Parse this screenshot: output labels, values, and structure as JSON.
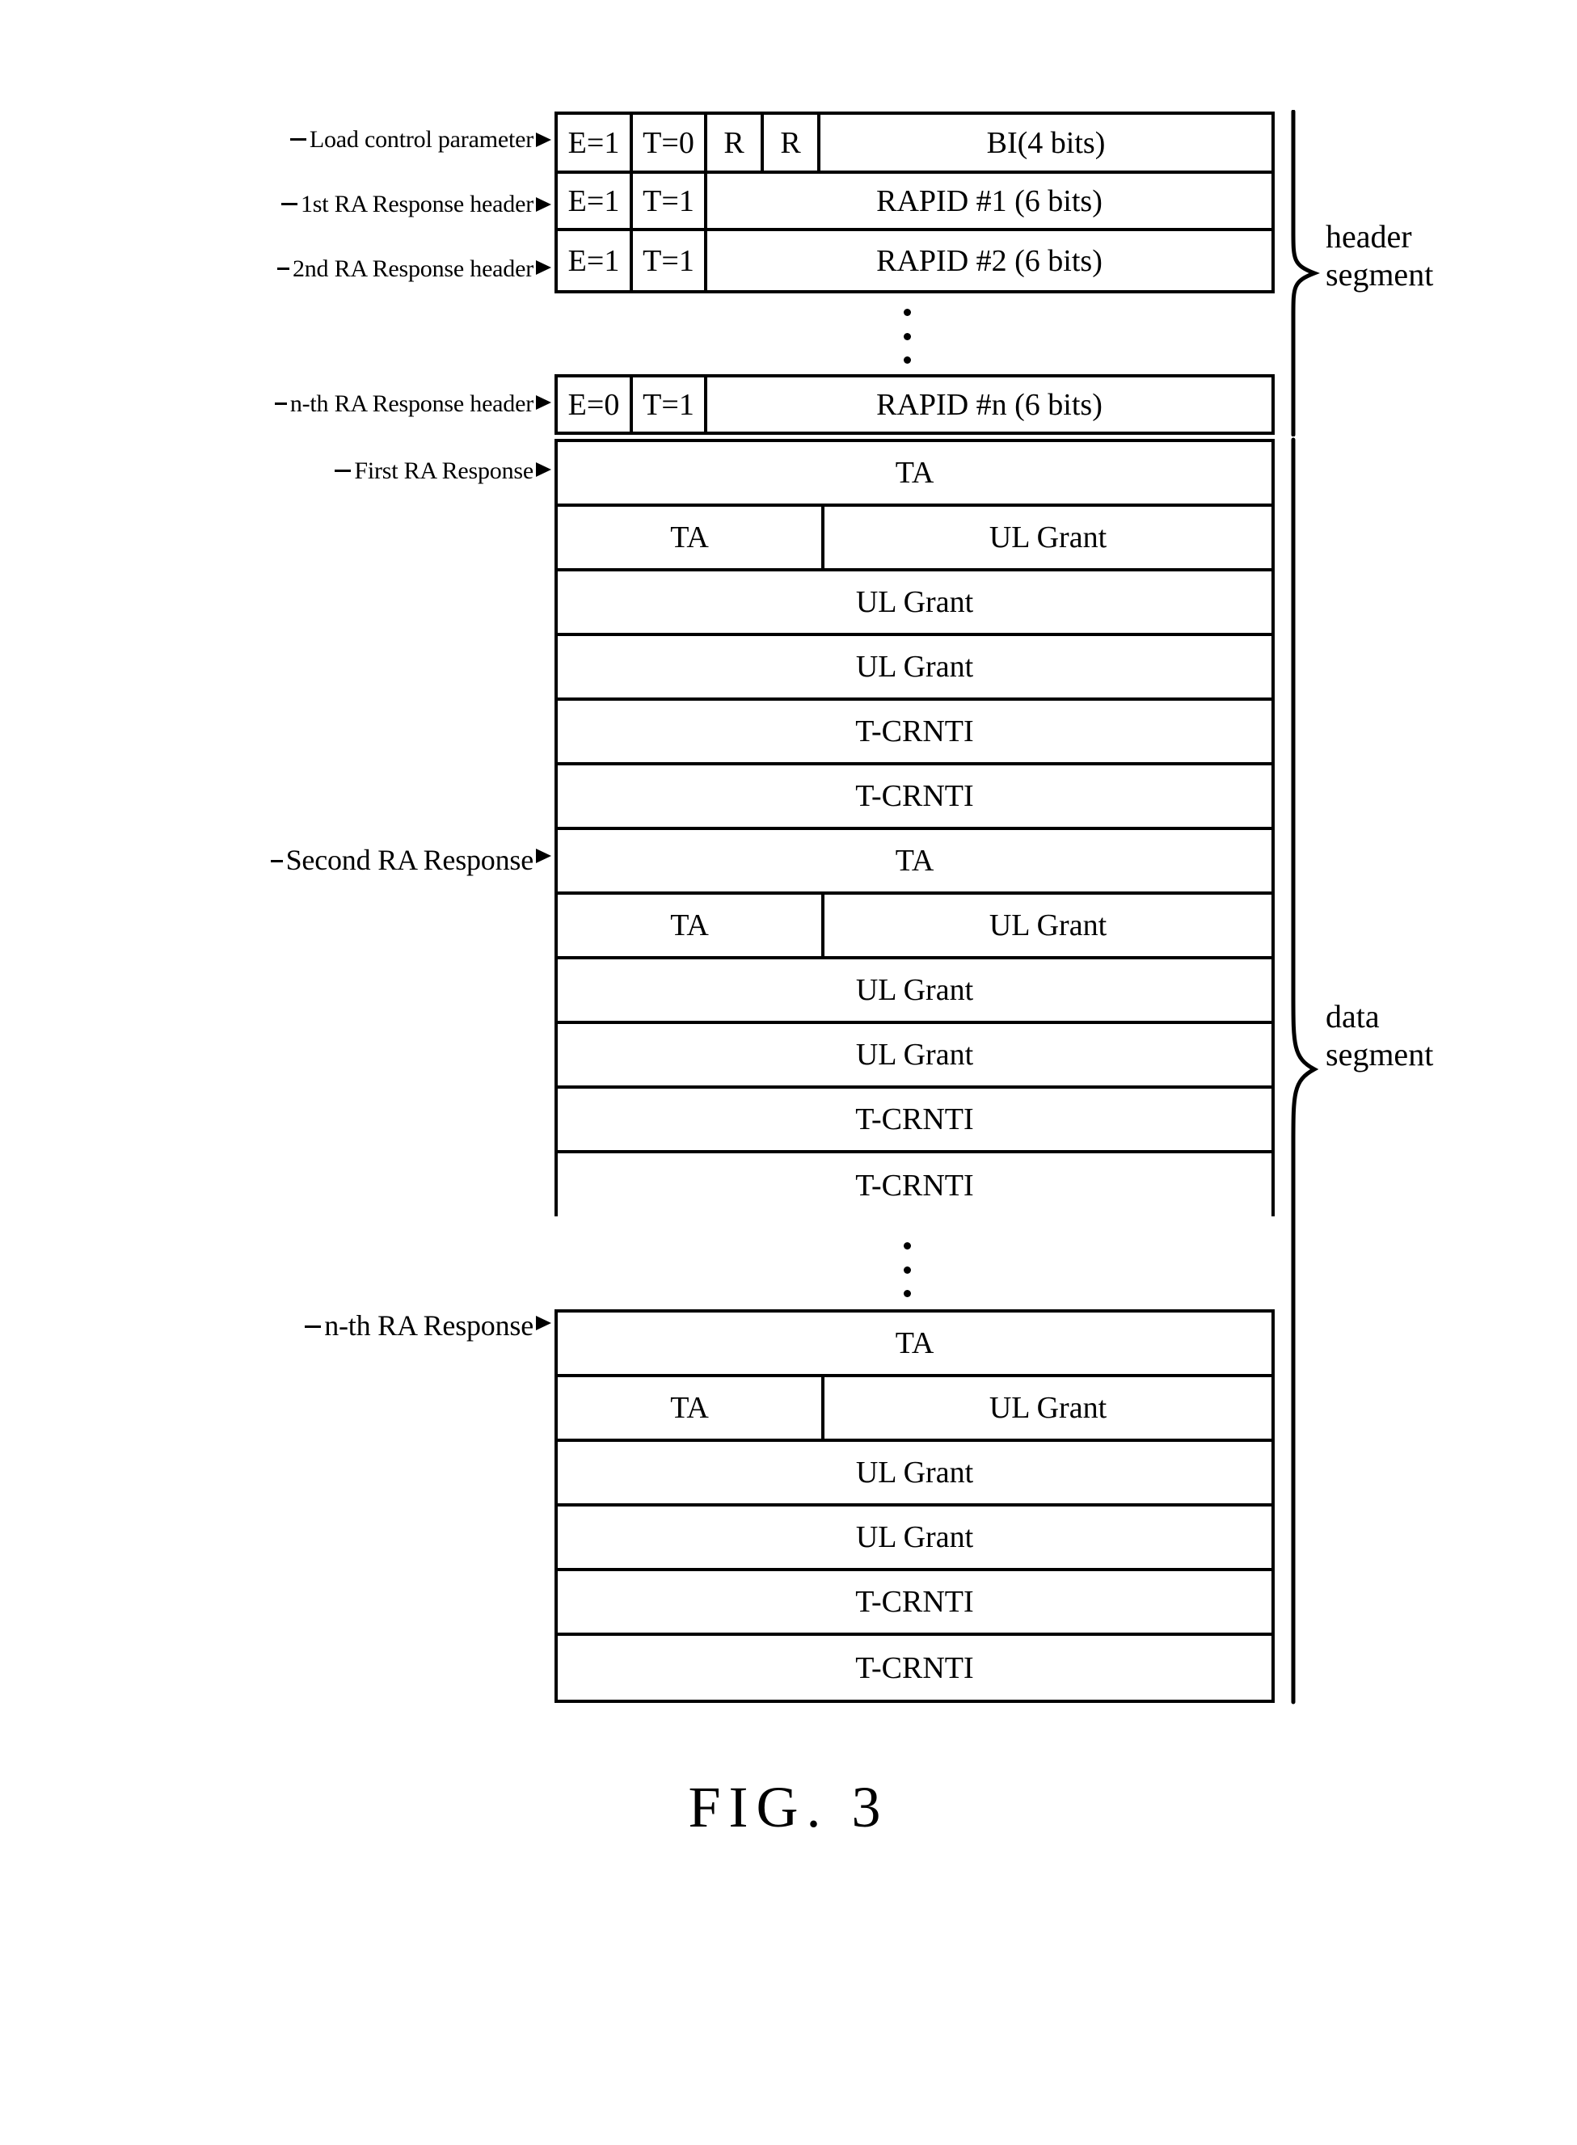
{
  "figure": {
    "caption": "FIG. 3"
  },
  "segments": {
    "header": {
      "label_line1": "header",
      "label_line2": "segment"
    },
    "data": {
      "label_line1": "data",
      "label_line2": "segment"
    }
  },
  "side_labels": {
    "load_control_parameter": "Load control parameter",
    "first_ra_response_header": "1st RA Response header",
    "second_ra_response_header": "2nd RA Response  header",
    "nth_ra_response_header": "n-th RA Response  header",
    "first_ra_response": "First RA Response",
    "second_ra_response": "Second RA Response",
    "nth_ra_response": "n-th RA Response"
  },
  "header_segment": {
    "rows": [
      {
        "name": "load-control-parameter-row",
        "cells": [
          {
            "text": "E=1"
          },
          {
            "text": "T=0"
          },
          {
            "text": "R"
          },
          {
            "text": "R"
          },
          {
            "text": "BI(4 bits)"
          }
        ]
      },
      {
        "name": "first-ra-response-header-row",
        "cells": [
          {
            "text": "E=1"
          },
          {
            "text": "T=1"
          },
          {
            "text": "RAPID #1 (6 bits)"
          }
        ]
      },
      {
        "name": "second-ra-response-header-row",
        "cells": [
          {
            "text": "E=1"
          },
          {
            "text": "T=1"
          },
          {
            "text": "RAPID #2 (6 bits)"
          }
        ]
      }
    ],
    "last_row": {
      "name": "nth-ra-response-header-row",
      "cells": [
        {
          "text": "E=0"
        },
        {
          "text": "T=1"
        },
        {
          "text": "RAPID #n (6 bits)"
        }
      ]
    }
  },
  "data_segment": {
    "first_response": {
      "rows": [
        {
          "cells": [
            {
              "text": "TA"
            }
          ]
        },
        {
          "cells": [
            {
              "text": "TA"
            },
            {
              "text": "UL Grant"
            }
          ]
        },
        {
          "cells": [
            {
              "text": "UL Grant"
            }
          ]
        },
        {
          "cells": [
            {
              "text": "UL Grant"
            }
          ]
        },
        {
          "cells": [
            {
              "text": "T-CRNTI"
            }
          ]
        },
        {
          "cells": [
            {
              "text": "T-CRNTI"
            }
          ]
        }
      ]
    },
    "second_response": {
      "rows": [
        {
          "cells": [
            {
              "text": "TA"
            }
          ]
        },
        {
          "cells": [
            {
              "text": "TA"
            },
            {
              "text": "UL Grant"
            }
          ]
        },
        {
          "cells": [
            {
              "text": "UL Grant"
            }
          ]
        },
        {
          "cells": [
            {
              "text": "UL Grant"
            }
          ]
        },
        {
          "cells": [
            {
              "text": "T-CRNTI"
            }
          ]
        },
        {
          "cells": [
            {
              "text": "T-CRNTI"
            }
          ]
        }
      ]
    },
    "nth_response": {
      "rows": [
        {
          "cells": [
            {
              "text": "TA"
            }
          ]
        },
        {
          "cells": [
            {
              "text": "TA"
            },
            {
              "text": "UL Grant"
            }
          ]
        },
        {
          "cells": [
            {
              "text": "UL Grant"
            }
          ]
        },
        {
          "cells": [
            {
              "text": "UL Grant"
            }
          ]
        },
        {
          "cells": [
            {
              "text": "T-CRNTI"
            }
          ]
        },
        {
          "cells": [
            {
              "text": "T-CRNTI"
            }
          ]
        }
      ]
    }
  },
  "colors": {
    "ink": "#000000",
    "paper": "#ffffff"
  }
}
